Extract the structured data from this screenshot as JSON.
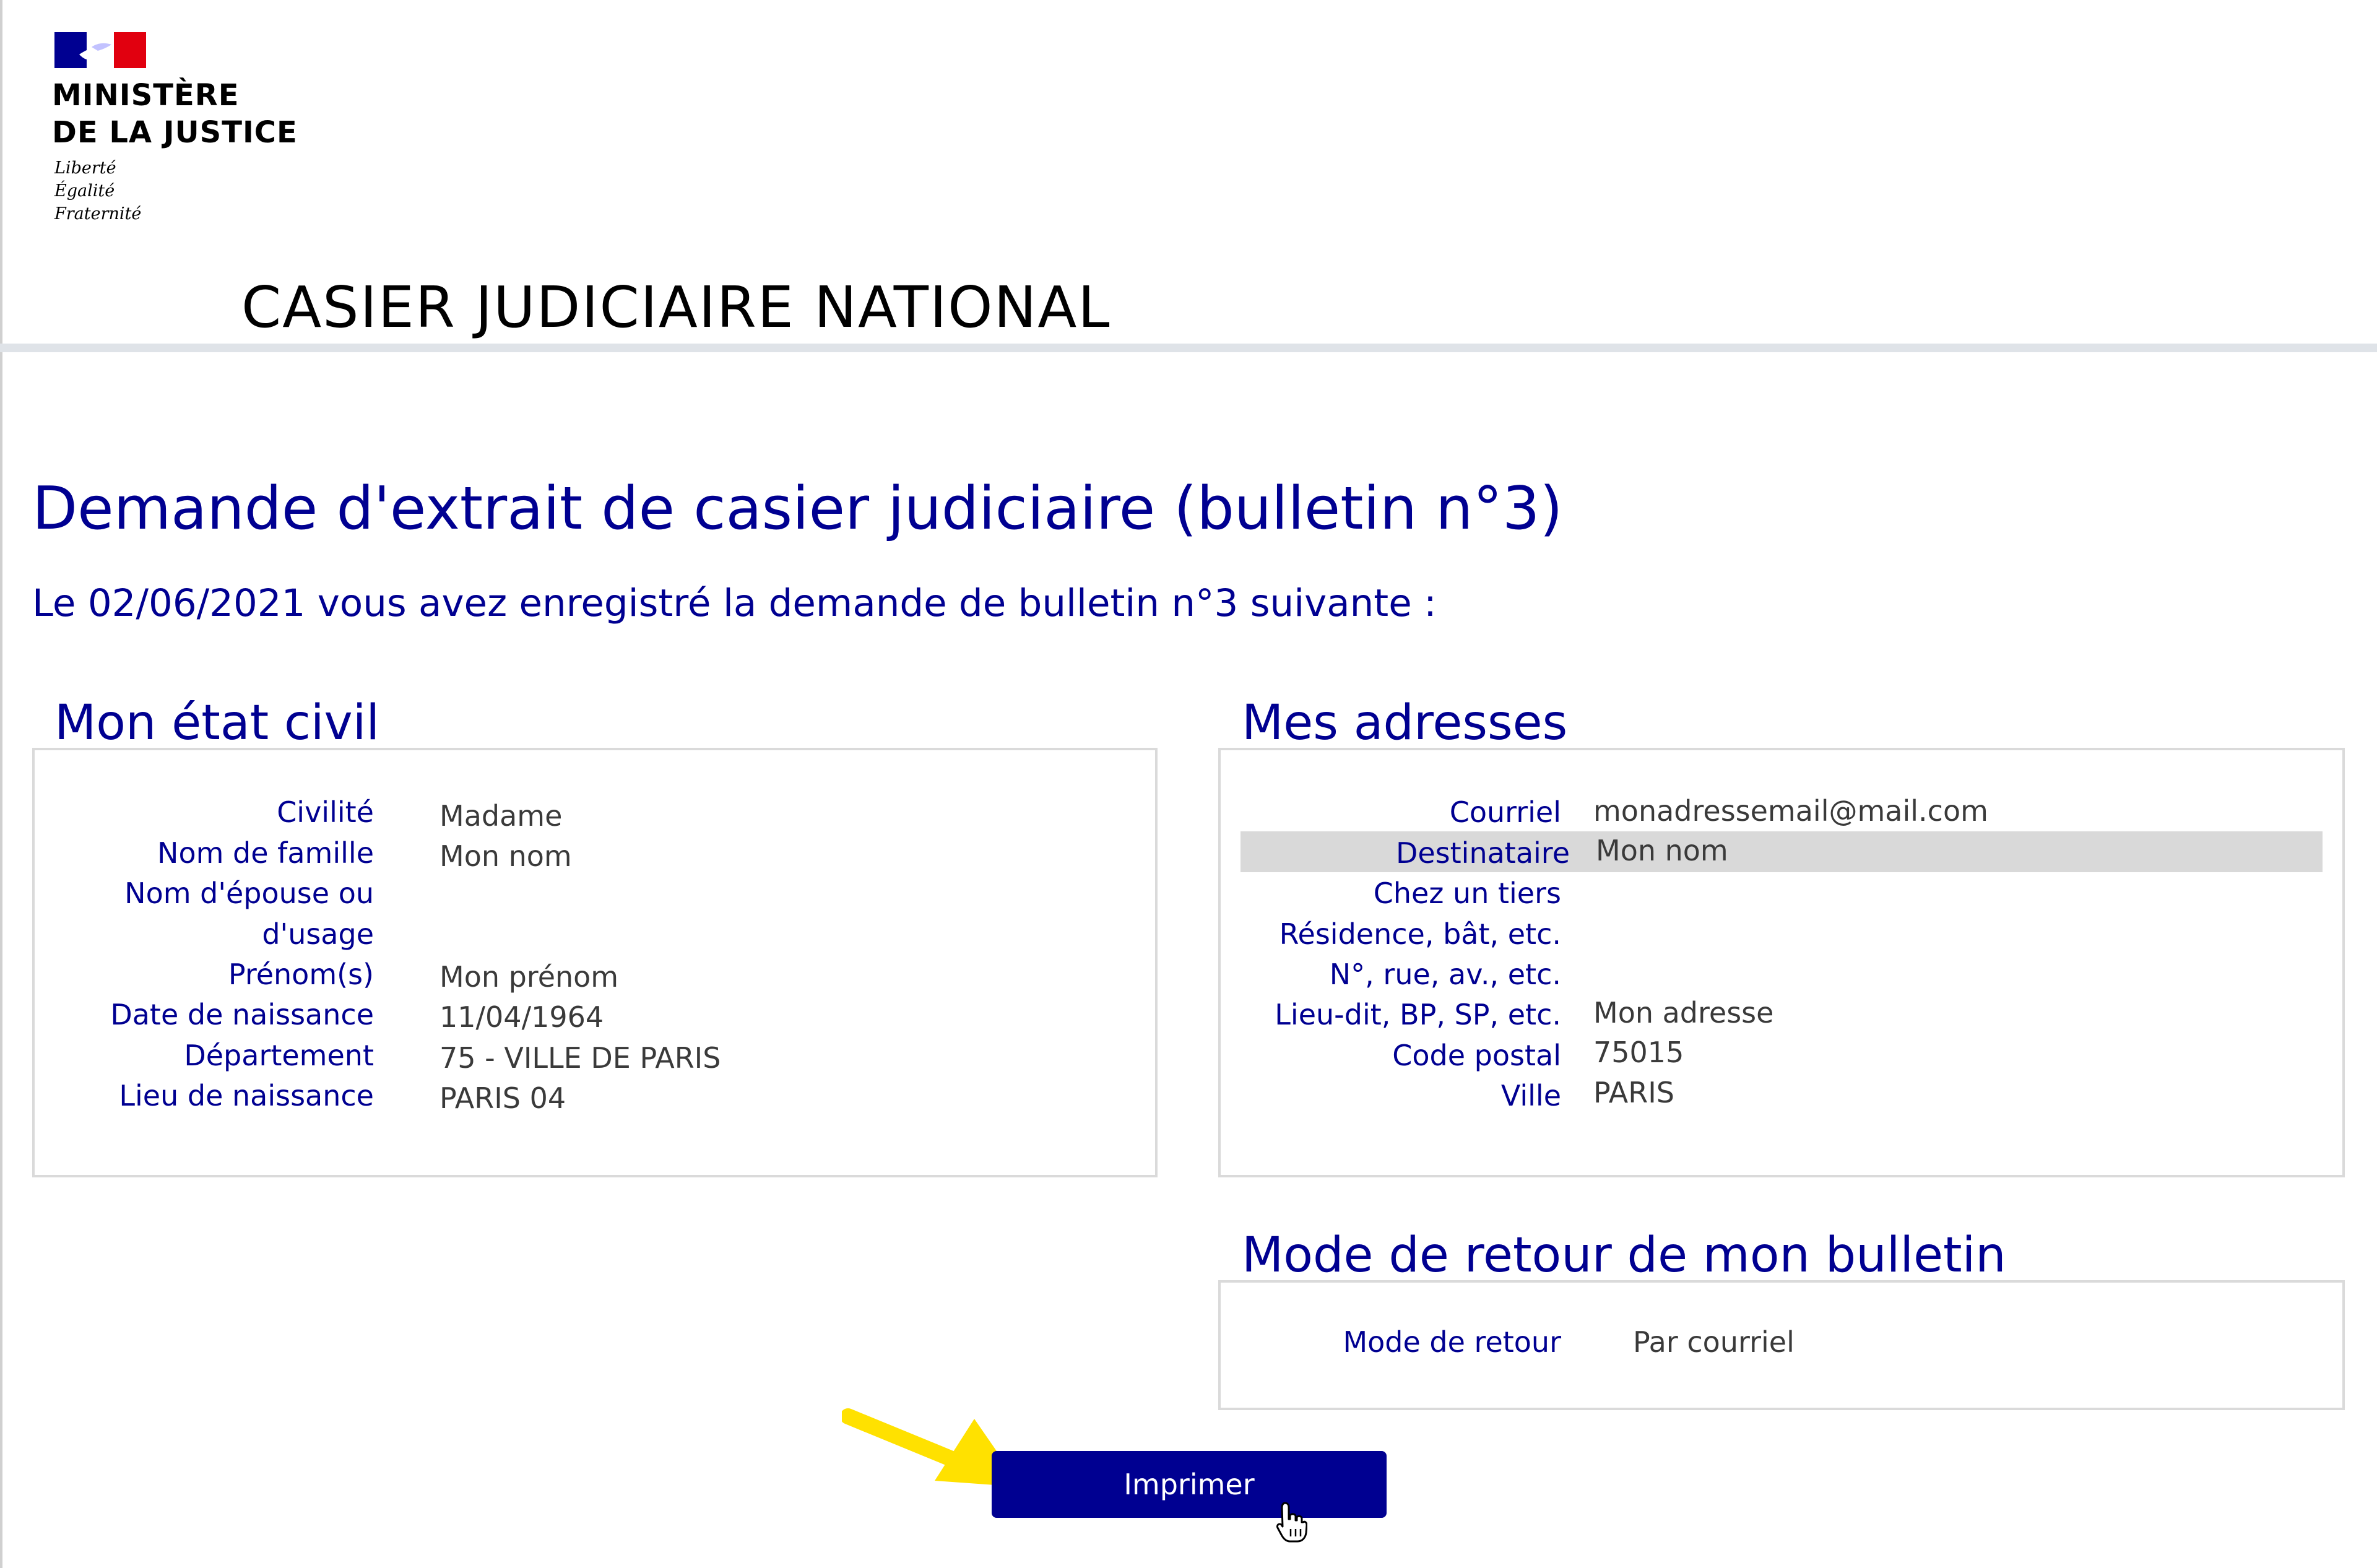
{
  "header": {
    "ministry_line1": "MINISTÈRE",
    "ministry_line2": "DE LA JUSTICE",
    "motto": [
      "Liberté",
      "Égalité",
      "Fraternité"
    ],
    "site_title": "CASIER JUDICIAIRE NATIONAL",
    "flag_colors": [
      "#000091",
      "#ffffff",
      "#e1000f"
    ]
  },
  "page": {
    "title": "Demande d'extrait de casier judiciaire (bulletin n°3)",
    "intro": "Le 02/06/2021 vous avez enregistré la demande de bulletin n°3 suivante :"
  },
  "etat_civil": {
    "title": "Mon état civil",
    "rows": [
      {
        "label": "Civilité",
        "value": "Madame"
      },
      {
        "label": "Nom de famille",
        "value": "Mon nom"
      },
      {
        "label": "Nom d'épouse ou",
        "value": ""
      },
      {
        "label": "d'usage",
        "value": ""
      },
      {
        "label": "Prénom(s)",
        "value": "Mon prénom"
      },
      {
        "label": "Date de naissance",
        "value": "11/04/1964"
      },
      {
        "label": "Département",
        "value": "75 - VILLE DE PARIS"
      },
      {
        "label": "Lieu de naissance",
        "value": "PARIS 04"
      }
    ]
  },
  "adresses": {
    "title": "Mes adresses",
    "rows": [
      {
        "label": "Courriel",
        "value": "monadressemail@mail.com"
      },
      {
        "label": "Destinataire",
        "value": "Mon nom"
      },
      {
        "label": "Chez un tiers",
        "value": ""
      },
      {
        "label": "Résidence, bât, etc.",
        "value": ""
      },
      {
        "label": "N°, rue, av., etc.",
        "value": ""
      },
      {
        "label": "Lieu-dit, BP, SP, etc.",
        "value": "Mon adresse"
      },
      {
        "label": "Code postal",
        "value": "75015"
      },
      {
        "label": "Ville",
        "value": "PARIS"
      }
    ]
  },
  "mode_retour": {
    "title": "Mode de retour de mon bulletin",
    "label": "Mode de retour",
    "value": "Par courriel"
  },
  "actions": {
    "print_label": "Imprimer"
  },
  "colors": {
    "primary": "#000091",
    "highlight_row": "#d9d9d9",
    "arrow": "#ffe100"
  }
}
